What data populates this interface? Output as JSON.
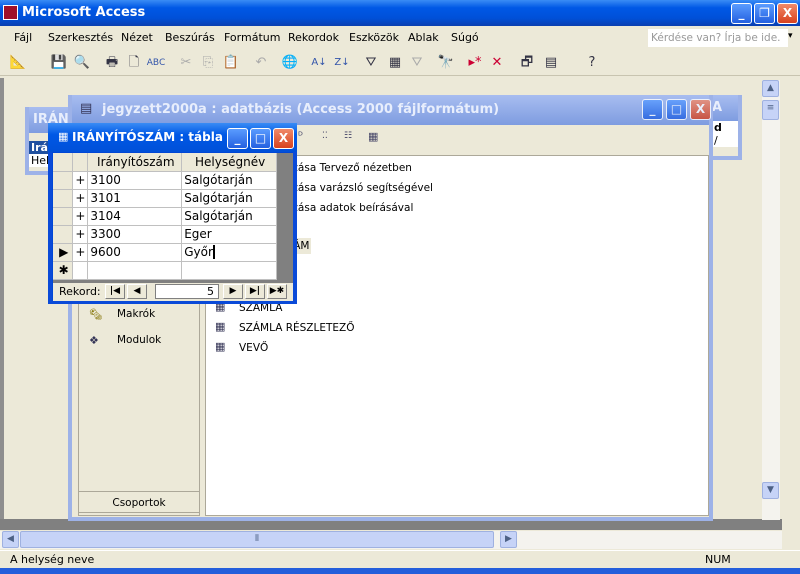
{
  "app": {
    "title": "Microsoft Access",
    "buttons": {
      "minimize": "_",
      "restore": "❐",
      "close": "X"
    }
  },
  "menu": [
    "Fájl",
    "Szerkesztés",
    "Nézet",
    "Beszúrás",
    "Formátum",
    "Rekordok",
    "Eszközök",
    "Ablak",
    "Súgó"
  ],
  "help_box": {
    "placeholder": "Kérdése van? Írja be ide."
  },
  "toolbar": [
    "design-view",
    "save",
    "search",
    "print",
    "print-preview",
    "spelling",
    "cut",
    "copy",
    "paste",
    "undo",
    "hyperlink",
    "sort-ascending",
    "sort-descending",
    "filter-by-selection",
    "filter-by-form",
    "apply-filter",
    "find",
    "new-record",
    "delete-record",
    "database-window",
    "new-object",
    "help"
  ],
  "back_window": {
    "title": "IRÁNY",
    "col": "Irán",
    "row": "Hely",
    "right_title": "A",
    "right_row1": "d",
    "right_row2": "/"
  },
  "db_window": {
    "title": "jegyzett2000a : adatbázis (Access 2000 fájlformátum)",
    "objects": [
      {
        "label": "Makrók",
        "icon": "macro-icon"
      },
      {
        "label": "Modulok",
        "icon": "module-icon"
      }
    ],
    "groups": "Csoportok",
    "list": [
      "ozása Tervező nézetben",
      "ozása varázsló segítségével",
      "ozása adatok beírásával",
      "ZÁM",
      "SZÁMLA",
      "SZÁMLA RÉSZLETEZŐ",
      "VEVŐ"
    ]
  },
  "table_window": {
    "title": "IRÁNYÍTÓSZÁM : tábla",
    "columns": [
      "Irányítószám",
      "Helységnév"
    ],
    "rows": [
      [
        "3100",
        "Salgótarján"
      ],
      [
        "3101",
        "Salgótarján"
      ],
      [
        "3104",
        "Salgótarján"
      ],
      [
        "3300",
        "Eger"
      ],
      [
        "9600",
        "Győr"
      ]
    ],
    "record_label": "Rekord:",
    "current_record": "5"
  },
  "status": {
    "text": "A helység neve",
    "num": "NUM"
  }
}
